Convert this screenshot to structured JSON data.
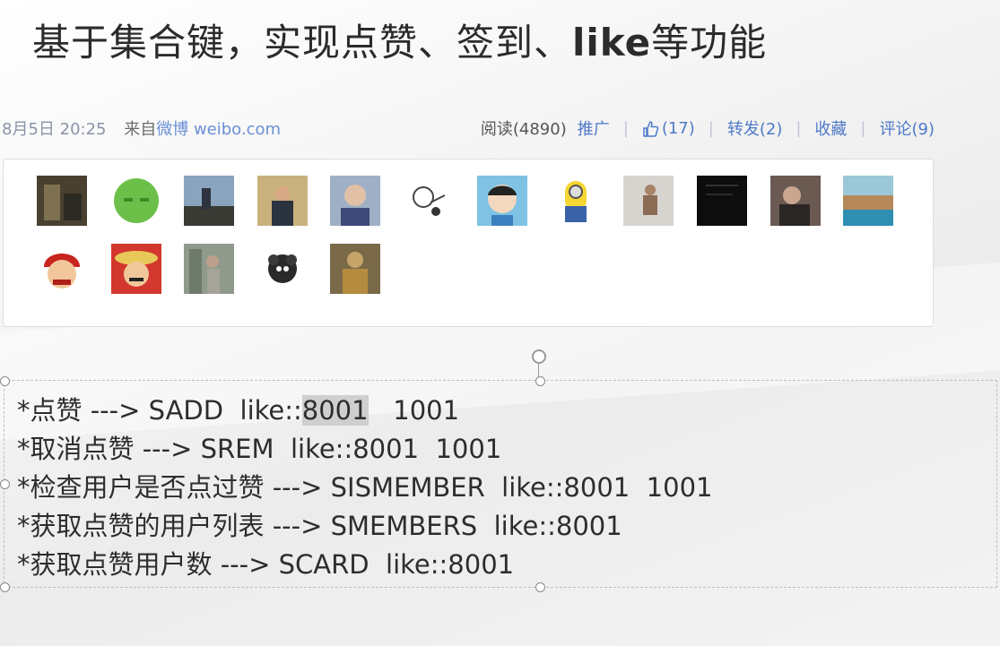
{
  "slide": {
    "title_main": "基于集合键，实现点赞、签到、",
    "title_bold": "like",
    "title_end": "等功能"
  },
  "weibo": {
    "date": "8月5日 20:25",
    "source_prefix": "来自",
    "source_link": "微博 weibo.com",
    "reads": "阅读(4890)",
    "promote": "推广",
    "likes": "(17)",
    "repost": "转发(2)",
    "favorite": "收藏",
    "comments": "评论(9)",
    "avatar_count": 17,
    "colors": {
      "link": "#4f79c9",
      "meta": "#8a93a8"
    }
  },
  "commands": [
    {
      "prefix": "*点赞 ---> SADD  like::",
      "highlight": "8001",
      "suffix": "   1001"
    },
    {
      "prefix": "*取消点赞 ---> SREM  like::8001  1001",
      "highlight": "",
      "suffix": ""
    },
    {
      "prefix": "*检查用户是否点过赞 ---> SISMEMBER  like::8001  1001",
      "highlight": "",
      "suffix": ""
    },
    {
      "prefix": "*获取点赞的用户列表 ---> SMEMBERS  like::8001",
      "highlight": "",
      "suffix": ""
    },
    {
      "prefix": "*获取点赞用户数 ---> SCARD  like::8001",
      "highlight": "",
      "suffix": ""
    }
  ]
}
